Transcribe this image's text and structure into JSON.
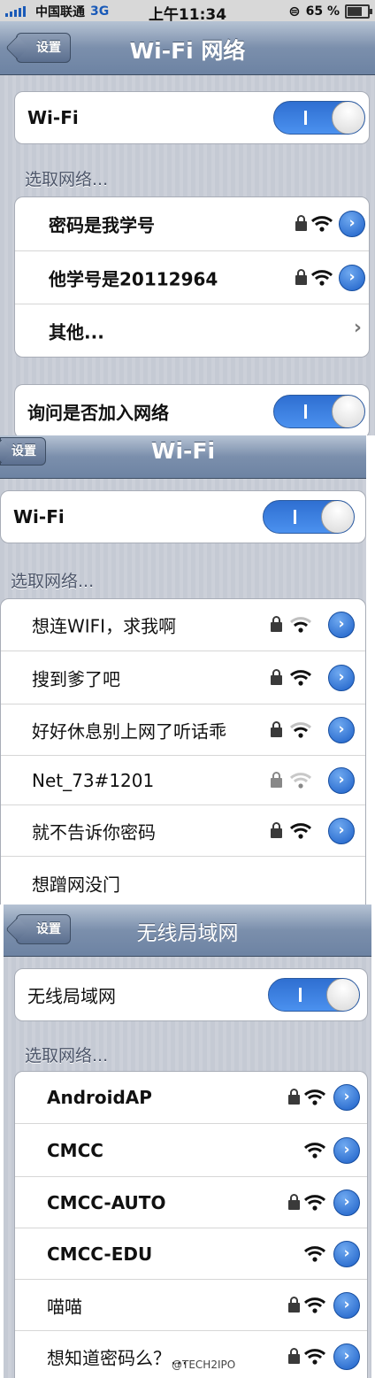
{
  "colors": {
    "accent": "#2f6fd1",
    "navbar": "#6d83a3"
  },
  "panel1": {
    "status": {
      "carrier": "中国联通",
      "network": "3G",
      "time": "上午11:34",
      "battery": "65 %"
    },
    "back": "设置",
    "title": "Wi-Fi 网络",
    "wifi_label": "Wi-Fi",
    "wifi_on": true,
    "choose": "选取网络...",
    "networks": [
      {
        "name": "密码是我学号",
        "lock": true,
        "wifi": "wifi-strong-icon"
      },
      {
        "name": "他学号是20112964",
        "lock": true,
        "wifi": "wifi-strong-icon"
      }
    ],
    "other": "其他...",
    "ask_label": "询问是否加入网络",
    "ask_on": true
  },
  "panel2": {
    "back": "设置",
    "title": "Wi-Fi",
    "wifi_label": "Wi-Fi",
    "wifi_on": true,
    "choose": "选取网络...",
    "networks": [
      {
        "name": "想连WIFI，求我啊",
        "lock": true,
        "wifi": "wifi-weak-icon"
      },
      {
        "name": "搜到爹了吧",
        "lock": true,
        "wifi": "wifi-strong-icon"
      },
      {
        "name": "好好休息别上网了听话乖",
        "lock": true,
        "wifi": "wifi-weak-icon"
      },
      {
        "name": "Net_73#1201",
        "lock": true,
        "wifi": "wifi-weak-icon"
      },
      {
        "name": "就不告诉你密码",
        "lock": true,
        "wifi": "wifi-strong-icon"
      },
      {
        "name": "想蹭网没门",
        "lock": false,
        "wifi": ""
      }
    ]
  },
  "panel3": {
    "back": "设置",
    "title": "无线局域网",
    "wifi_label": "无线局域网",
    "wifi_on": true,
    "choose": "选取网络...",
    "networks": [
      {
        "name": "AndroidAP",
        "lock": true,
        "wifi": "wifi-strong-icon"
      },
      {
        "name": "CMCC",
        "lock": false,
        "wifi": "wifi-strong-icon"
      },
      {
        "name": "CMCC-AUTO",
        "lock": true,
        "wifi": "wifi-strong-icon"
      },
      {
        "name": "CMCC-EDU",
        "lock": false,
        "wifi": "wifi-strong-icon"
      },
      {
        "name": "喵喵",
        "lock": true,
        "wifi": "wifi-strong-icon"
      },
      {
        "name": "想知道密码么？...",
        "lock": true,
        "wifi": "wifi-strong-icon"
      }
    ],
    "watermark": "@TECH2IPO"
  }
}
